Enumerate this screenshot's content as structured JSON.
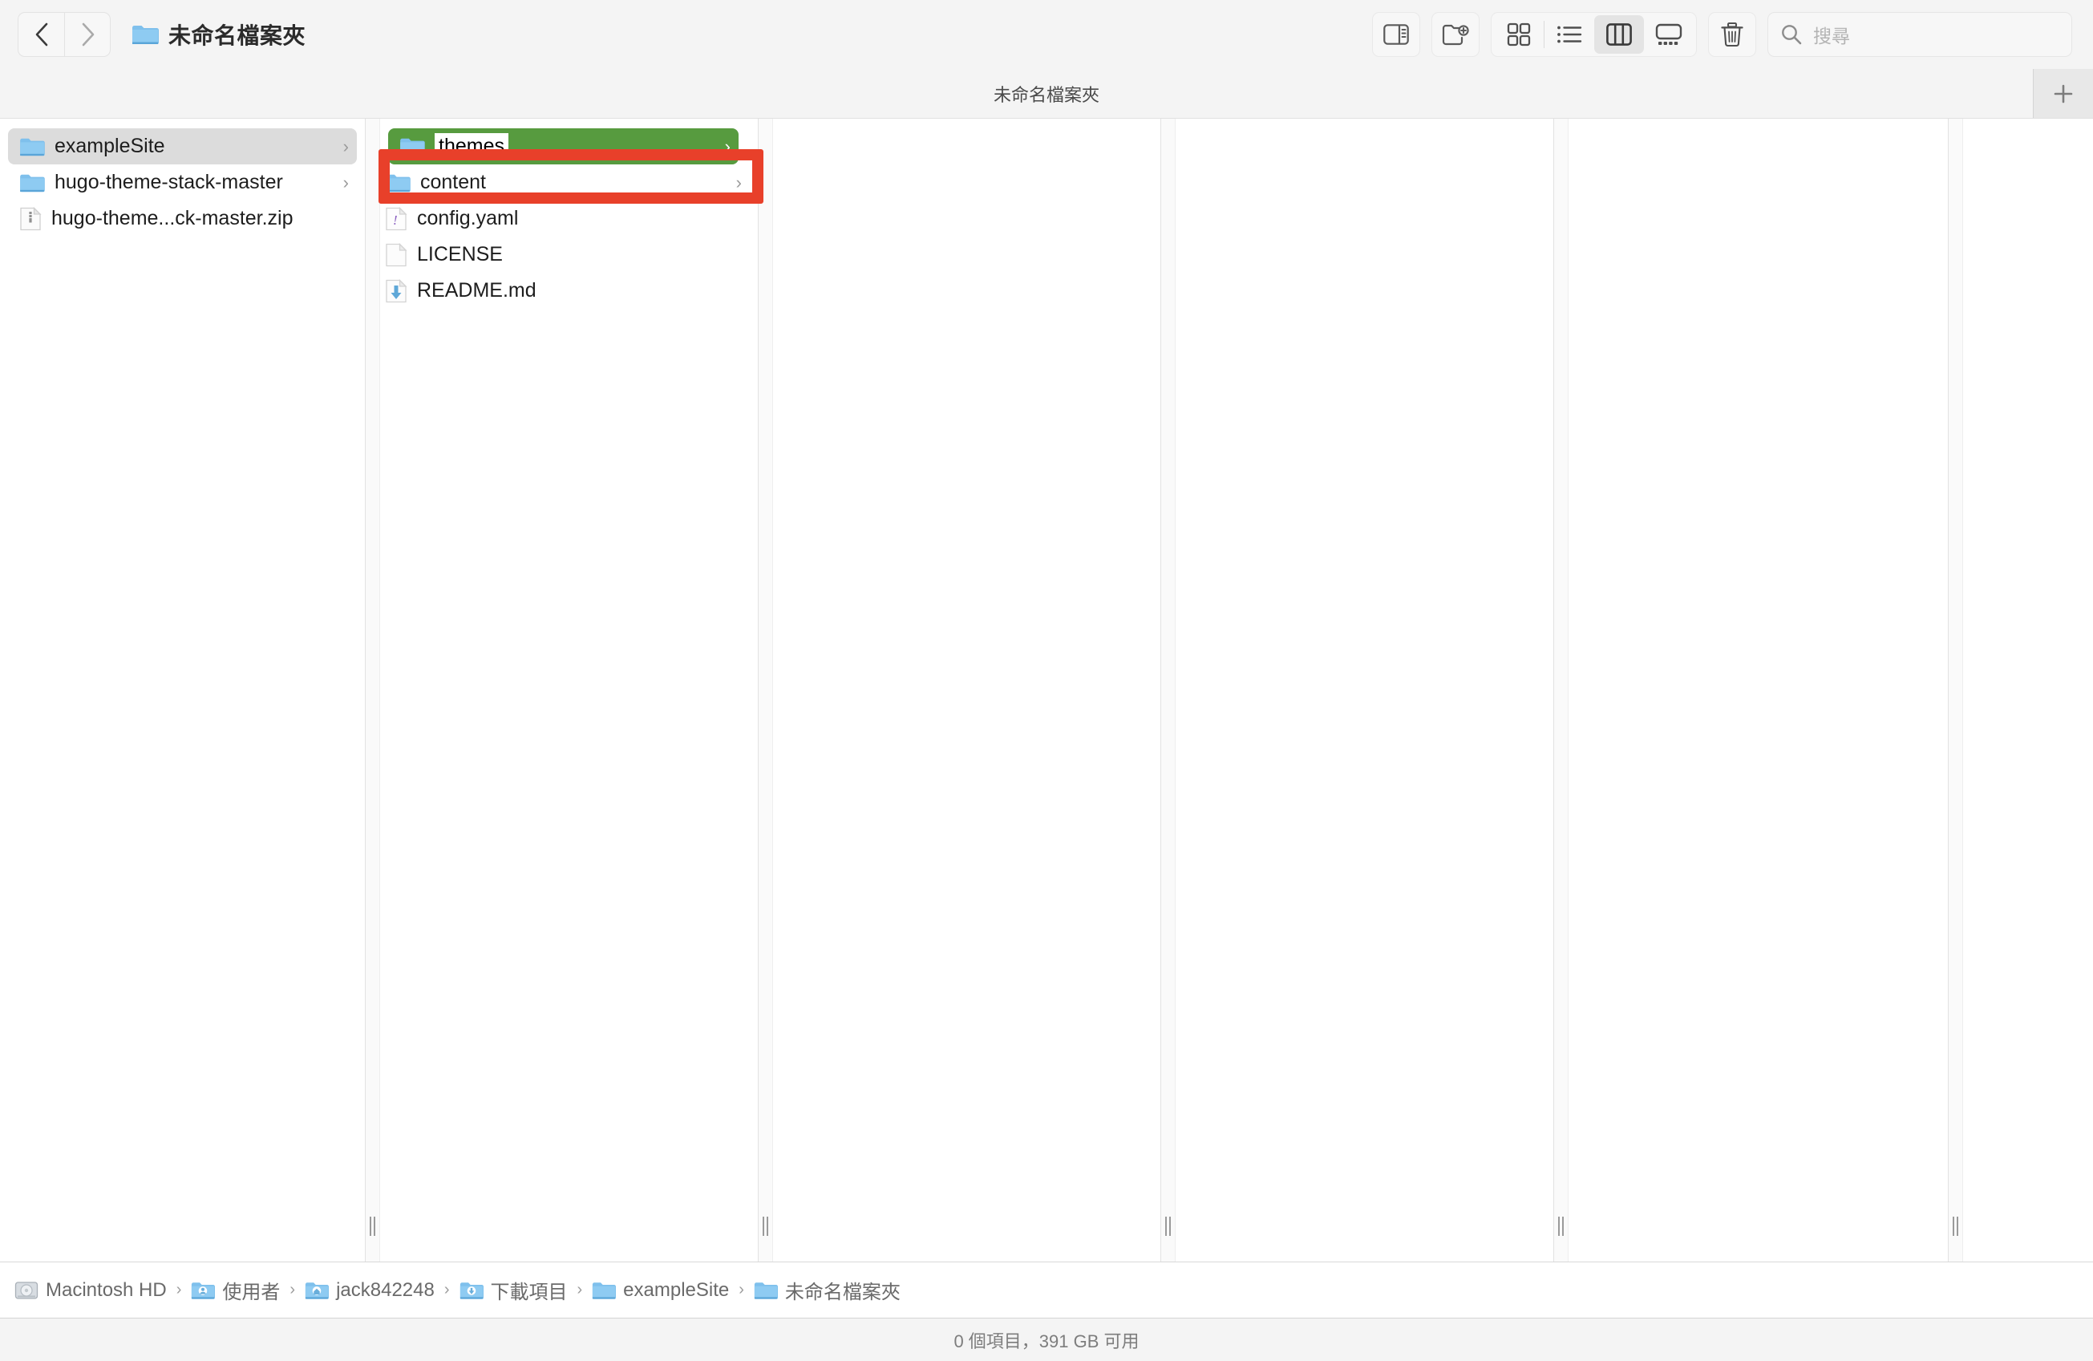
{
  "window": {
    "title": "未命名檔案夾",
    "title_icon": "folder-icon",
    "subtitle": "未命名檔案夾"
  },
  "toolbar": {
    "back_label": "‹",
    "back_icon": "chevron-left-icon",
    "forward_label": "›",
    "forward_icon": "chevron-right-icon",
    "sidebar_toggle_icon": "sidebar-toggle-icon",
    "new_folder_icon": "new-folder-icon",
    "view_icon_grid": "grid-view-icon",
    "view_list": "list-view-icon",
    "view_column": "column-view-icon",
    "view_gallery": "gallery-view-icon",
    "active_view": "column",
    "trash_icon": "trash-icon",
    "add_tab_label": "+",
    "add_tab_icon": "plus-icon"
  },
  "search": {
    "icon": "search-icon",
    "placeholder": "搜尋",
    "value": ""
  },
  "columns": [
    {
      "index": 0,
      "items": [
        {
          "name": "exampleSite",
          "icon": "folder-icon",
          "kind": "folder",
          "has_chevron": true,
          "state": "selected"
        },
        {
          "name": "hugo-theme-stack-master",
          "icon": "folder-icon",
          "kind": "folder",
          "has_chevron": true,
          "state": "normal"
        },
        {
          "name": "hugo-theme...ck-master.zip",
          "icon": "zip-file-icon",
          "kind": "file",
          "has_chevron": false,
          "state": "normal"
        }
      ]
    },
    {
      "index": 1,
      "items": [
        {
          "name": "themes",
          "icon": "folder-icon",
          "kind": "folder",
          "has_chevron": true,
          "state": "renaming-highlighted"
        },
        {
          "name": "content",
          "icon": "folder-icon",
          "kind": "folder",
          "has_chevron": true,
          "state": "normal"
        },
        {
          "name": "config.yaml",
          "icon": "yaml-file-icon",
          "kind": "file",
          "has_chevron": false,
          "state": "normal"
        },
        {
          "name": "LICENSE",
          "icon": "plain-file-icon",
          "kind": "file",
          "has_chevron": false,
          "state": "normal"
        },
        {
          "name": "README.md",
          "icon": "markdown-file-icon",
          "kind": "file",
          "has_chevron": false,
          "state": "normal"
        }
      ]
    },
    {
      "index": 2,
      "items": []
    },
    {
      "index": 3,
      "items": []
    },
    {
      "index": 4,
      "items": []
    },
    {
      "index": 5,
      "items": []
    }
  ],
  "annotation": {
    "color": "#e8402a",
    "target": "themes",
    "highlight_color": "#579b3f"
  },
  "path_bar": [
    {
      "label": "Macintosh HD",
      "icon": "hard-disk-icon"
    },
    {
      "label": "使用者",
      "icon": "users-folder-icon"
    },
    {
      "label": "jack842248",
      "icon": "home-folder-icon"
    },
    {
      "label": "下載項目",
      "icon": "downloads-folder-icon"
    },
    {
      "label": "exampleSite",
      "icon": "folder-icon"
    },
    {
      "label": "未命名檔案夾",
      "icon": "folder-icon"
    }
  ],
  "path_separator": "›",
  "status": {
    "text": "0 個項目，391 GB 可用"
  }
}
